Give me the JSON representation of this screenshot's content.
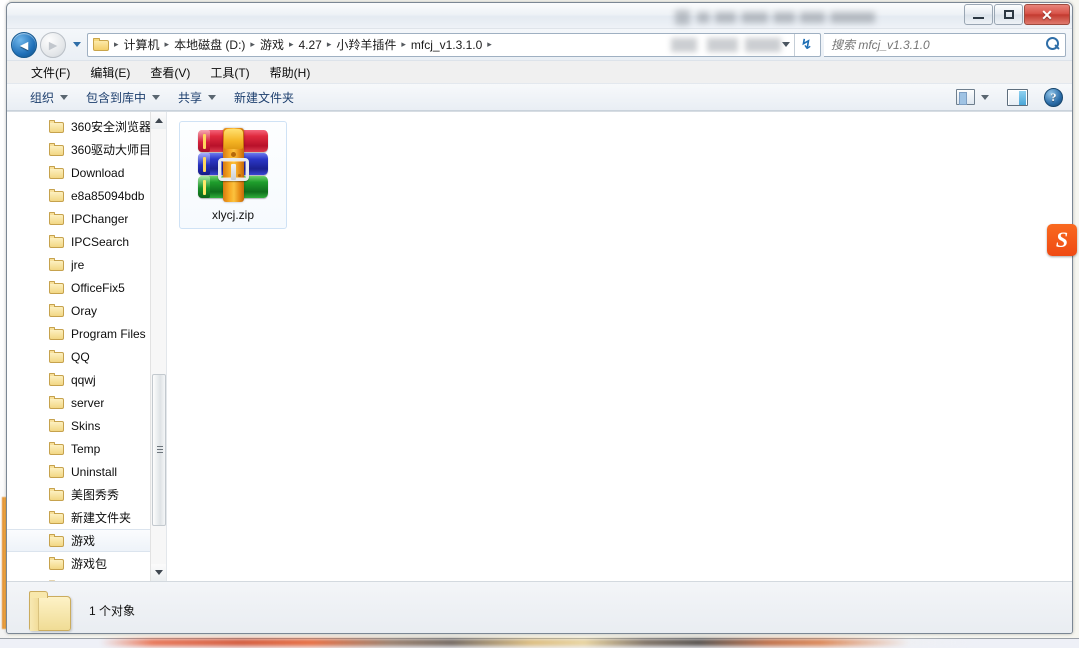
{
  "window": {
    "title_obscured": true,
    "controls": {
      "minimize": "最小化",
      "restore": "还原",
      "close": "关闭",
      "close_glyph": "✕"
    }
  },
  "address": {
    "back_tooltip": "后退",
    "forward_tooltip": "前进",
    "back_glyph": "◄",
    "forward_glyph": "►",
    "history_dropdown": "最近浏览的位置",
    "breadcrumbs": [
      {
        "label": "计算机"
      },
      {
        "label": "本地磁盘 (D:)"
      },
      {
        "label": "游戏"
      },
      {
        "label": "4.27"
      },
      {
        "label": "小羚羊插件"
      },
      {
        "label": "mfcj_v1.3.1.0"
      }
    ],
    "separator": "▸",
    "refresh_glyph": "↯",
    "refresh_tooltip": "刷新"
  },
  "search": {
    "placeholder": "搜索 mfcj_v1.3.1.0",
    "value": ""
  },
  "menubar": {
    "items": [
      {
        "label": "文件(F)"
      },
      {
        "label": "编辑(E)"
      },
      {
        "label": "查看(V)"
      },
      {
        "label": "工具(T)"
      },
      {
        "label": "帮助(H)"
      }
    ]
  },
  "toolbar": {
    "items": [
      {
        "label": "组织",
        "has_caret": true
      },
      {
        "label": "包含到库中",
        "has_caret": true
      },
      {
        "label": "共享",
        "has_caret": true
      },
      {
        "label": "新建文件夹",
        "has_caret": false
      }
    ],
    "view_button": "更改您的视图",
    "view_caret": "视图选项",
    "preview_pane": "显示预览窗格",
    "help_button": "获取帮助",
    "help_glyph": "?"
  },
  "navpane": {
    "items": [
      {
        "label": "360安全浏览器",
        "selected": false
      },
      {
        "label": "360驱动大师目",
        "selected": false
      },
      {
        "label": "Download",
        "selected": false
      },
      {
        "label": "e8a85094bdb",
        "selected": false
      },
      {
        "label": "IPChanger",
        "selected": false
      },
      {
        "label": "IPCSearch",
        "selected": false
      },
      {
        "label": "jre",
        "selected": false
      },
      {
        "label": "OfficeFix5",
        "selected": false
      },
      {
        "label": "Oray",
        "selected": false
      },
      {
        "label": "Program Files",
        "selected": false
      },
      {
        "label": "QQ",
        "selected": false
      },
      {
        "label": "qqwj",
        "selected": false
      },
      {
        "label": "server",
        "selected": false
      },
      {
        "label": "Skins",
        "selected": false
      },
      {
        "label": "Temp",
        "selected": false
      },
      {
        "label": "Uninstall",
        "selected": false
      },
      {
        "label": "美图秀秀",
        "selected": false
      },
      {
        "label": "新建文件夹",
        "selected": false
      },
      {
        "label": "游戏",
        "selected": true
      },
      {
        "label": "游戏包",
        "selected": false
      }
    ],
    "scroll_up": "向上滚动",
    "scroll_down": "向下滚动"
  },
  "content": {
    "files": [
      {
        "name": "xlycj.zip",
        "type": "zip-archive",
        "icon": "winrar-archive-icon",
        "selected": true
      }
    ]
  },
  "statusbar": {
    "text": "1 个对象",
    "icon": "folder-icon"
  },
  "overlay": {
    "sogou_logo": "S"
  },
  "colors": {
    "accent_blue": "#1f6fb4",
    "close_red": "#c33b30",
    "folder_yellow": "#f2d784",
    "selection_blue": "#cfe2f5",
    "sogou_orange": "#ef4a12"
  }
}
